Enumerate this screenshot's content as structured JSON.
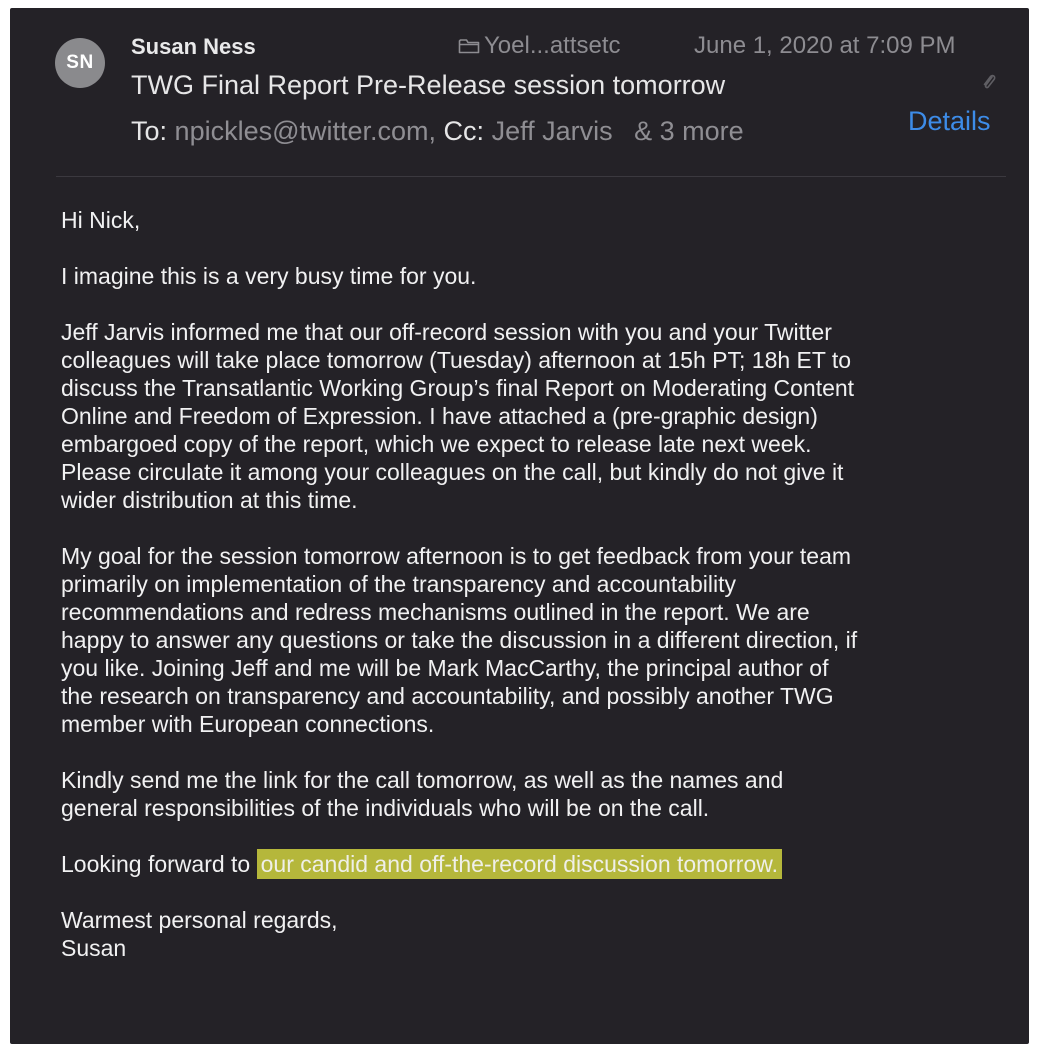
{
  "header": {
    "avatar_initials": "SN",
    "sender": "Susan Ness",
    "folder": "Yoel...attsetc",
    "date": "June 1, 2020 at 7:09 PM",
    "subject": "TWG Final Report Pre-Release session tomorrow",
    "to_label": "To:",
    "to_value": "npickles@twitter.com,",
    "cc_label": "Cc:",
    "cc_value": "Jeff Jarvis",
    "more": "& 3 more",
    "details_label": "Details"
  },
  "body": {
    "greeting": "Hi Nick,",
    "p1": "I imagine this is a very busy time for you.",
    "p2": "Jeff Jarvis informed me that our off-record session with you and your Twitter\ncolleagues will take place tomorrow (Tuesday) afternoon at 15h PT; 18h ET to\ndiscuss the Transatlantic Working Group’s final Report on Moderating Content\nOnline and Freedom of Expression.  I have attached a (pre-graphic design)\nembargoed copy of the report, which we expect to release late next week.\nPlease circulate it among your colleagues on the call, but kindly do not give it\nwider distribution at this time.",
    "p3": "My goal for the session tomorrow afternoon is to get feedback from your team\nprimarily on implementation of the transparency and accountability\nrecommendations and redress mechanisms outlined in the report.  We are\nhappy to answer any questions or take the discussion in a different direction, if\nyou like.  Joining Jeff and me will be Mark MacCarthy, the principal author of\nthe research on transparency and accountability, and possibly another TWG\nmember with European connections.",
    "p4": "Kindly send me the link for the call tomorrow, as well as the names and\ngeneral responsibilities of the individuals who will be on the call.",
    "p5_prefix": "Looking forward to",
    "p5_highlight": "our candid and off-the-record discussion tomorrow.",
    "closing": "Warmest personal regards,",
    "signature": "Susan"
  },
  "colors": {
    "background": "#242227",
    "link": "#3d8ce8",
    "highlight": "#b5b73b"
  },
  "icons": [
    "folder-icon",
    "paperclip-icon"
  ]
}
